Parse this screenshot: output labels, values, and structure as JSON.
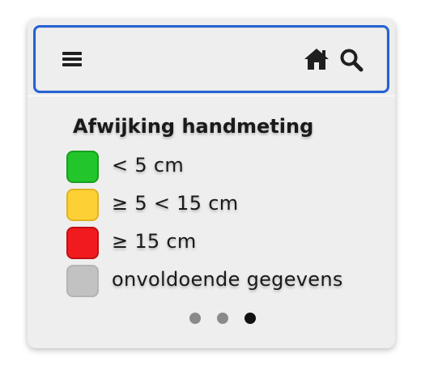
{
  "colors": {
    "toolbar_border": "#2563d6",
    "panel_bg": "#eeeeee",
    "icon": "#1f1f1f",
    "dot_inactive": "#8a8a8a",
    "dot_active": "#111111"
  },
  "toolbar": {
    "menu_icon": "hamburger-menu-icon",
    "home_icon": "home-icon",
    "search_icon": "magnifier-search-icon"
  },
  "legend": {
    "title": "Afwijking handmeting",
    "items": [
      {
        "label": "< 5 cm",
        "color": "#22c62a",
        "border": "#1a9e21"
      },
      {
        "label": "≥ 5 < 15 cm",
        "color": "#fdd035",
        "border": "#e0b420"
      },
      {
        "label": "≥ 15 cm",
        "color": "#f11a1e",
        "border": "#c21014"
      },
      {
        "label": "onvoldoende gegevens",
        "color": "#c2c2c2",
        "border": "#b4b4b4"
      }
    ]
  },
  "pagination": {
    "total": 3,
    "active_index": 2
  }
}
